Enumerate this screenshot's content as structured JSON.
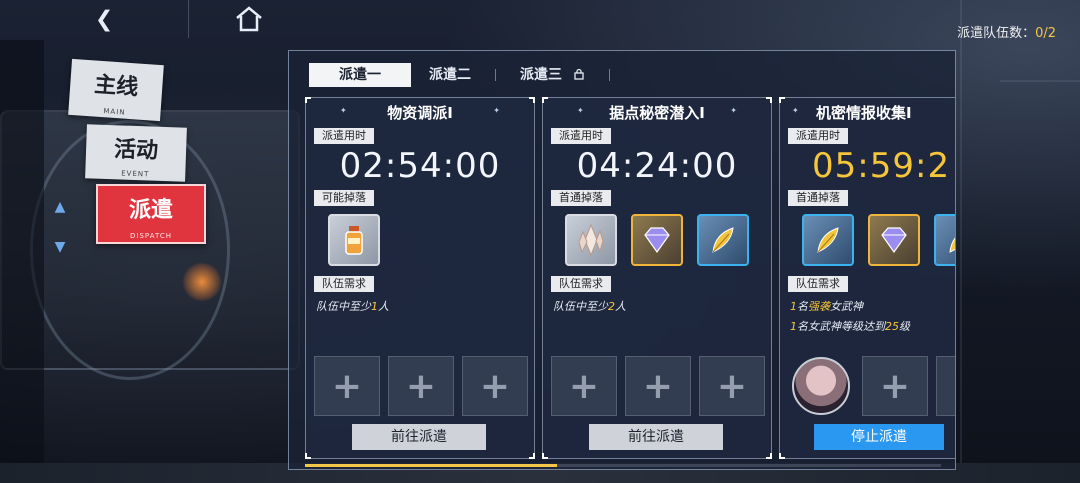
{
  "nav": {
    "back_icon": "back-arrow-icon",
    "home_icon": "home-icon"
  },
  "team_count": {
    "label": "派遣队伍数：",
    "value": "0/2"
  },
  "side_menu": [
    {
      "cn": "主线",
      "en": "MAIN"
    },
    {
      "cn": "活动",
      "en": "EVENT"
    },
    {
      "cn": "派遣",
      "en": "DISPATCH",
      "active": true
    }
  ],
  "tabs": [
    {
      "label": "派遣一",
      "active": true
    },
    {
      "label": "派遣二"
    },
    {
      "label": "派遣三",
      "locked": true
    }
  ],
  "cards": [
    {
      "title": "物资调派I",
      "time_label": "派遣用时",
      "time": "02:54:00",
      "drop_label": "可能掉落",
      "req_label": "队伍需求",
      "req_lines": [
        {
          "pre": "队伍中至少",
          "hl": "1",
          "post": "人"
        }
      ],
      "action": "前往派遣"
    },
    {
      "title": "据点秘密潜入I",
      "time_label": "派遣用时",
      "time": "04:24:00",
      "drop_label": "首通掉落",
      "req_label": "队伍需求",
      "req_lines": [
        {
          "pre": "队伍中至少",
          "hl": "2",
          "post": "人"
        }
      ],
      "action": "前往派遣"
    },
    {
      "title": "机密情报收集I",
      "time_label": "派遣用时",
      "time": "05:59:2",
      "drop_label": "首通掉落",
      "req_label": "队伍需求",
      "req_lines": [
        {
          "pre": "",
          "hl": "1",
          "mid": "名",
          "hl2": "强袭",
          "post": "女武神"
        },
        {
          "pre": "",
          "hl": "1",
          "mid": "名女武神等级达到",
          "hl2": "25",
          "post": "级"
        }
      ],
      "action": "停止派遣"
    }
  ],
  "colors": {
    "accent_gold": "#f5c53a",
    "dispatch_red": "#e0343f",
    "stop_blue": "#2a97f0"
  }
}
